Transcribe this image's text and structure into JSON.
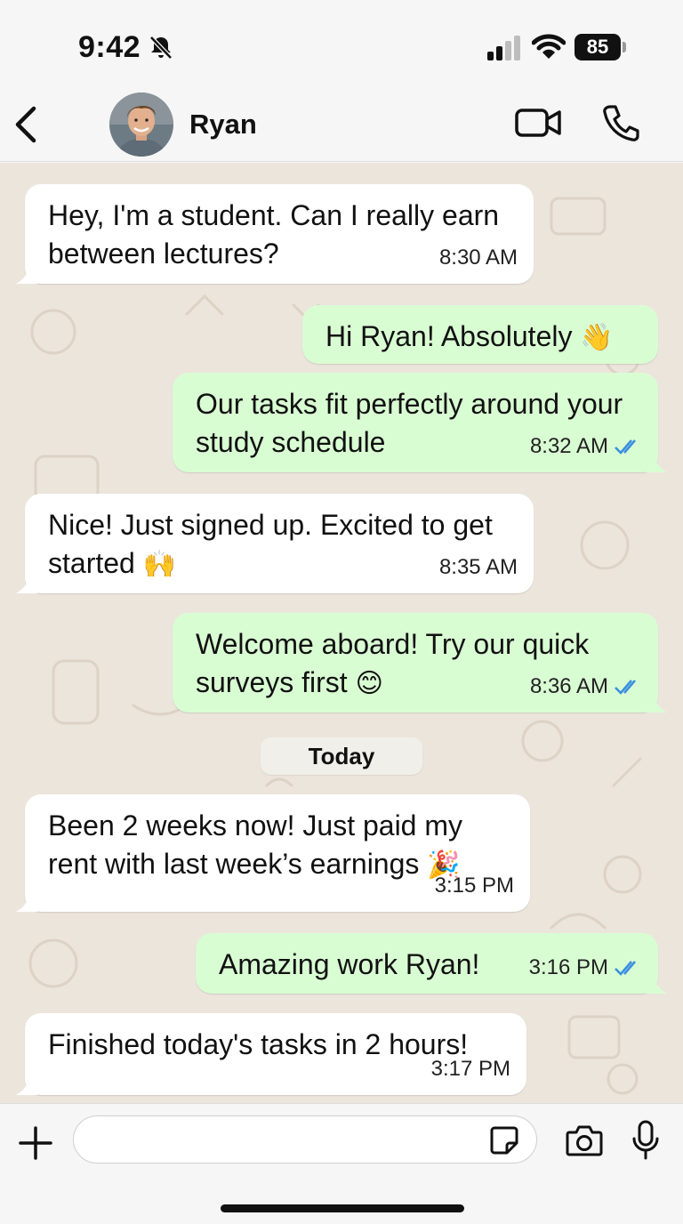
{
  "status_bar": {
    "time": "9:42",
    "battery": "85"
  },
  "header": {
    "back_label": "Back",
    "contact_name": "Ryan"
  },
  "messages": [
    {
      "dir": "in",
      "text": "Hey, I'm a student. Can I really earn between lectures?",
      "time": "8:30 AM"
    },
    {
      "dir": "out",
      "text": "Hi Ryan! Absolutely",
      "emoji": "👋",
      "time": ""
    },
    {
      "dir": "out",
      "text": "Our tasks fit perfectly around your study schedule",
      "time": "8:32 AM",
      "read": true
    },
    {
      "dir": "in",
      "text": "Nice! Just signed up. Excited to get started",
      "emoji": "🙌",
      "time": "8:35 AM"
    },
    {
      "dir": "out",
      "text": "Welcome aboard! Try our quick surveys first",
      "emoji": "😊",
      "time": "8:36 AM",
      "read": true
    },
    {
      "dir": "in",
      "text": "Been 2 weeks now! Just paid my rent with last week’s earnings",
      "emoji": "🎉",
      "time": "3:15 PM"
    },
    {
      "dir": "out",
      "text": "Amazing work Ryan!",
      "time": "3:16 PM",
      "read": true
    },
    {
      "dir": "in",
      "text": "Finished today's tasks in 2 hours!",
      "time": "3:17 PM"
    }
  ],
  "date_divider": "Today",
  "input": {
    "value": "",
    "placeholder": ""
  },
  "colors": {
    "incoming": "#ffffff",
    "outgoing": "#d9fdd3",
    "chat_bg": "#ece5dc",
    "read_ticks": "#3b8fe0"
  },
  "icons": [
    "chevron-left-icon",
    "video-call-icon",
    "phone-icon",
    "plus-icon",
    "sticker-icon",
    "camera-icon",
    "mic-icon",
    "bell-off-icon",
    "signal-icon",
    "wifi-icon"
  ]
}
